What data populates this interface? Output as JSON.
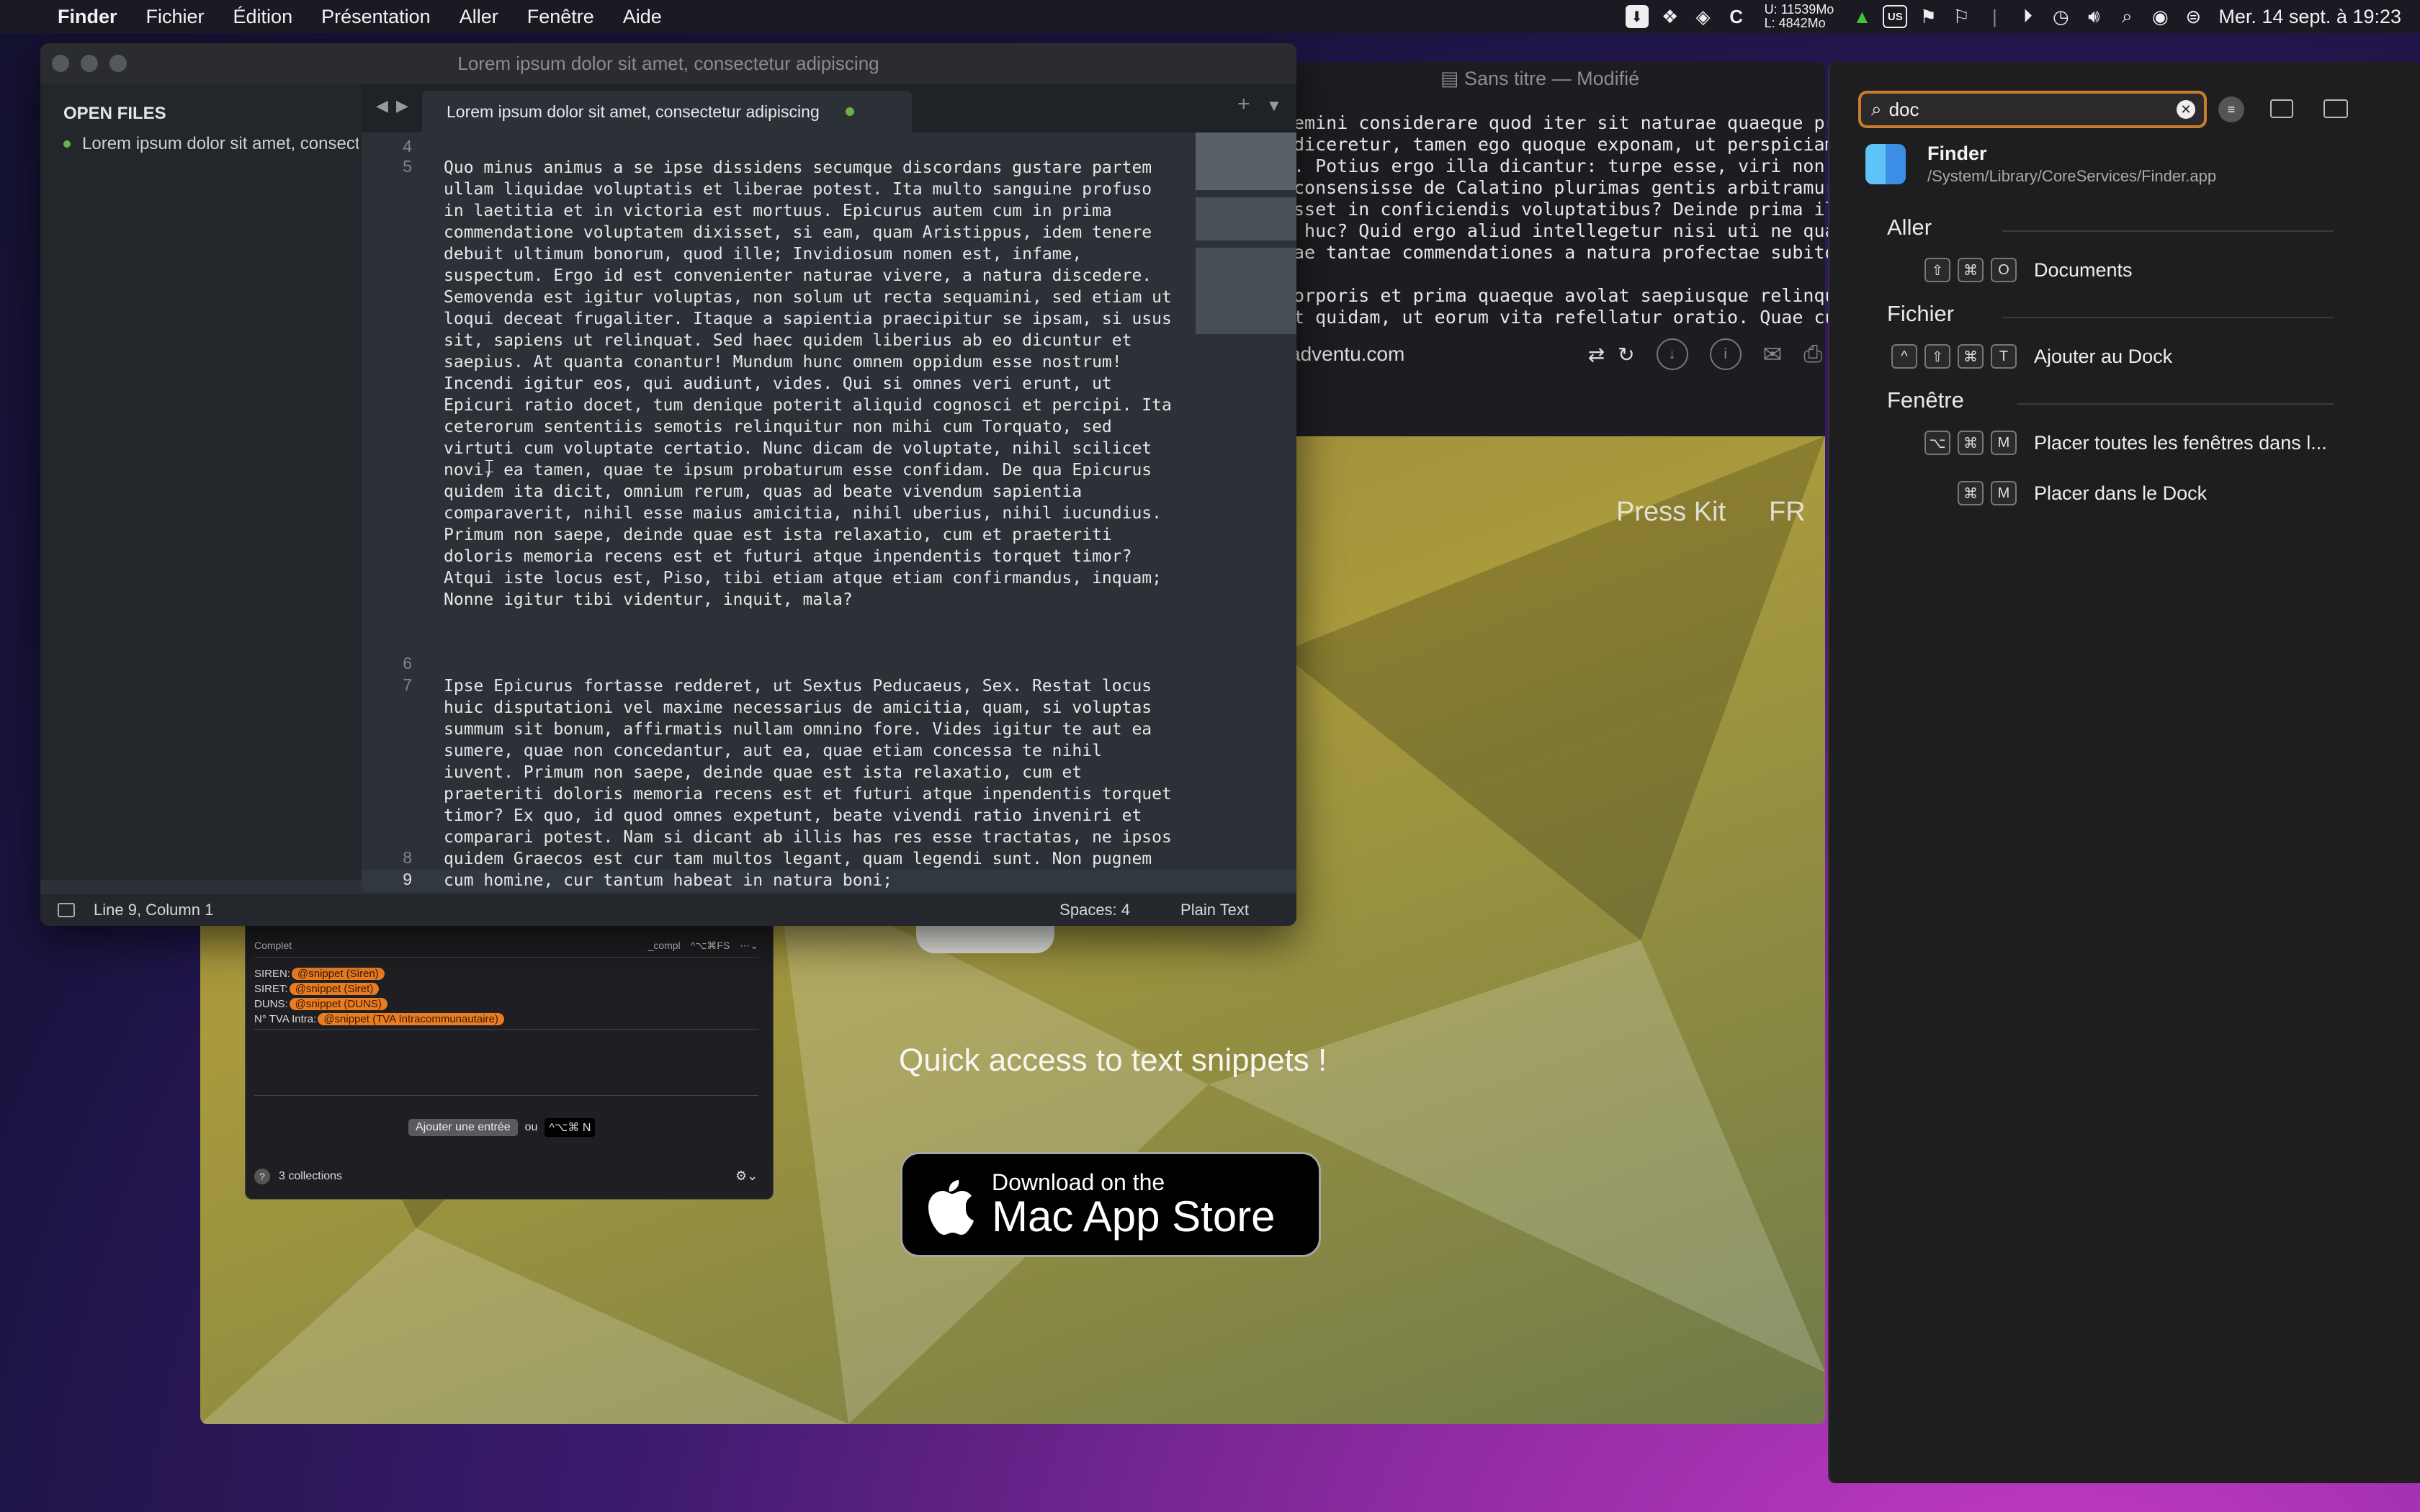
{
  "menubar": {
    "app_name": "Finder",
    "items": [
      "Fichier",
      "Édition",
      "Présentation",
      "Aller",
      "Fenêtre",
      "Aide"
    ],
    "memory": "U: 11539Mo\nL: 4842Mo",
    "keyboard_layout": "US",
    "datetime": "Mer. 14 sept. à 19:23",
    "icons": [
      "apple-icon",
      "download-icon",
      "dropbox-icon",
      "layers-icon",
      "c-icon",
      "upload-arrow-icon",
      "input-source-icon",
      "flag-icon",
      "flag-icon",
      "play-icon",
      "time-machine-icon",
      "volume-icon",
      "search-icon",
      "user-icon",
      "control-center-icon"
    ]
  },
  "editor": {
    "window_title": "Lorem ipsum dolor sit amet, consectetur adipiscing",
    "sidebar_heading": "OPEN FILES",
    "sidebar_file": "Lorem ipsum dolor sit amet, consectetur adipiscing",
    "tab_label": "Lorem ipsum dolor sit amet, consectetur adipiscing",
    "line_numbers": [
      "4",
      "5",
      "6",
      "7",
      "8",
      "9"
    ],
    "paragraph_5": "Quo minus animus a se ipse dissidens secumque discordans gustare partem\nullam liquidae voluptatis et liberae potest. Ita multo sanguine profuso\nin laetitia et in victoria est mortuus. Epicurus autem cum in prima\ncommendatione voluptatem dixisset, si eam, quam Aristippus, idem tenere\ndebuit ultimum bonorum, quod ille; Invidiosum nomen est, infame,\nsuspectum. Ergo id est convenienter naturae vivere, a natura discedere.\nSemovenda est igitur voluptas, non solum ut recta sequamini, sed etiam ut\nloqui deceat frugaliter. Itaque a sapientia praecipitur se ipsam, si usus\nsit, sapiens ut relinquat. Sed haec quidem liberius ab eo dicuntur et\nsaepius. At quanta conantur! Mundum hunc omnem oppidum esse nostrum!\nIncendi igitur eos, qui audiunt, vides. Qui si omnes veri erunt, ut\nEpicuri ratio docet, tum denique poterit aliquid cognosci et percipi. Ita\nceterorum sententiis semotis relinquitur non mihi cum Torquato, sed\nvirtuti cum voluptate certatio. Nunc dicam de voluptate, nihil scilicet\nnovi, ea tamen, quae te ipsum probaturum esse confidam. De qua Epicurus\nquidem ita dicit, omnium rerum, quas ad beate vivendum sapientia\ncomparaverit, nihil esse maius amicitia, nihil uberius, nihil iucundius.\nPrimum non saepe, deinde quae est ista relaxatio, cum et praeteriti\ndoloris memoria recens est et futuri atque inpendentis torquet timor?\nAtqui iste locus est, Piso, tibi etiam atque etiam confirmandus, inquam;\nNonne igitur tibi videntur, inquit, mala?",
    "paragraph_7": "Ipse Epicurus fortasse redderet, ut Sextus Peducaeus, Sex. Restat locus\nhuic disputationi vel maxime necessarius de amicitia, quam, si voluptas\nsummum sit bonum, affirmatis nullam omnino fore. Vides igitur te aut ea\nsumere, quae non concedantur, aut ea, quae etiam concessa te nihil\niuvent. Primum non saepe, deinde quae est ista relaxatio, cum et\npraeteriti doloris memoria recens est et futuri atque inpendentis torquet\ntimor? Ex quo, id quod omnes expetunt, beate vivendi ratio inveniri et\ncomparari potest. Nam si dicant ab illis has res esse tractatas, ne ipsos\nquidem Graecos est cur tam multos legant, quam legendi sunt. Non pugnem\ncum homine, cur tantum habeat in natura boni;",
    "status_position": "Line 9, Column 1",
    "status_spaces": "Spaces: 4",
    "status_syntax": "Plain Text"
  },
  "browser": {
    "doc_title": "Sans titre",
    "doc_state": "Modifié",
    "doc_text": "emini considerare quod iter sit naturae quaeque progress\ndiceretur, tamen ego quoque exponam, ut perspiciamus, si\n. Potius ergo illa dicantur: turpe esse, viri non esse d\nconsensisse de Calatino plurimas gentis arbitramur, prim\nsset in conficiendis voluptatibus? Deinde prima illa, qu\n huc? Quid ergo aliud intellegetur nisi uti ne quae pars\nae tantae commendationes a natura profectae subito a sap\n\norporis et prima quaeque avolat saepiusque relinquit cau\nt quidam, ut eorum vita refellatur oratio. Quae cum ita",
    "url": "adventu.com",
    "nav_press_kit": "Press Kit",
    "nav_lang": "FR",
    "tagline": "Quick access to text snippets !",
    "appstore_line1": "Download on the",
    "appstore_line2": "Mac App Store"
  },
  "snippets": {
    "mode": "Complet",
    "shortcut_compl": "_compl",
    "shortcut_keys": "^⌥⌘FS",
    "rows": [
      {
        "label": "SIREN:",
        "tag": "@snippet (Siren)"
      },
      {
        "label": "SIRET:",
        "tag": "@snippet (Siret)"
      },
      {
        "label": "DUNS:",
        "tag": "@snippet (DUNS)"
      },
      {
        "label": "N° TVA Intra:",
        "tag": "@snippet (TVA Intracommunautaire)"
      }
    ],
    "add_button": "Ajouter une entrée",
    "or": "ou",
    "add_shortcut": "^⌥⌘ N",
    "collections": "3 collections"
  },
  "menu_search": {
    "query": "doc",
    "app_name": "Finder",
    "app_path": "/System/Library/CoreServices/Finder.app",
    "sections": [
      {
        "title": "Aller",
        "items": [
          {
            "keys": [
              "⇧",
              "⌘",
              "O"
            ],
            "label": "Documents"
          }
        ]
      },
      {
        "title": "Fichier",
        "items": [
          {
            "keys": [
              "^",
              "⇧",
              "⌘",
              "T"
            ],
            "label": "Ajouter au Dock"
          }
        ]
      },
      {
        "title": "Fenêtre",
        "items": [
          {
            "keys": [
              "⌥",
              "⌘",
              "M"
            ],
            "label": "Placer toutes les fenêtres dans l..."
          },
          {
            "keys": [
              "⌘",
              "M"
            ],
            "label": "Placer dans le Dock"
          }
        ]
      }
    ]
  },
  "colors": {
    "accent_search": "#c97d2c",
    "snippet_tag": "#e87d24",
    "modified_dot": "#6ab04c"
  }
}
